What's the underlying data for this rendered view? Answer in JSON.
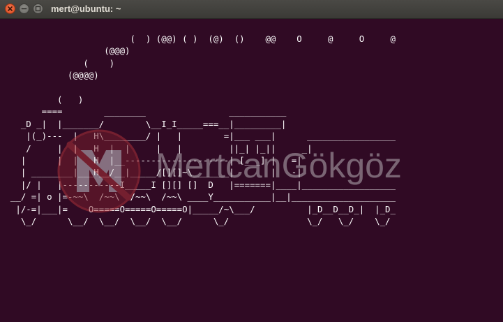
{
  "window": {
    "title": "mert@ubuntu: ~"
  },
  "terminal": {
    "ascii_art_lines": [
      "                         (  ) (@@) ( )  (@)  ()    @@    O     @     O     @",
      "                    (@@@)",
      "                (    )",
      "             (@@@@)",
      "",
      "           (   )",
      "        ====        ________                ___________",
      "    _D _|  |_______/        \\__I_I_____===__|_________|",
      "     |(_)---  |   H\\________/ |   |        =|___ ___|      _________________",
      "     /     |  |   H  |  |     |   |         ||_| |_||     _|",
      "    |      |  |   H  |__--------------------| [___] |   =|",
      "    | ________|___H__/__|_____/[][]~\\_______|       |   -|",
      "    |/ |   |-----------I_____I [][] []  D   |=======|____|__________________",
      "  __/ =| o |=-~~\\  /~~\\  /~~\\  /~~\\ ____Y___________|__|____________________",
      "   |/-=|___|=    O=====O=====O=====O|_____/~\\___/          |_D__D__D_|  |_D_",
      "    \\_/      \\__/  \\__/  \\__/  \\__/      \\_/               \\_/   \\_/    \\_/"
    ]
  },
  "watermark": {
    "text": "MertcanGökgöz",
    "logo_colors": [
      "#b8353b",
      "#7a1f2c"
    ]
  },
  "colors": {
    "terminal_bg": "#300a24",
    "terminal_fg": "#ffffff",
    "titlebar_bg": "#3c3b37",
    "close_button": "#e9592c"
  }
}
